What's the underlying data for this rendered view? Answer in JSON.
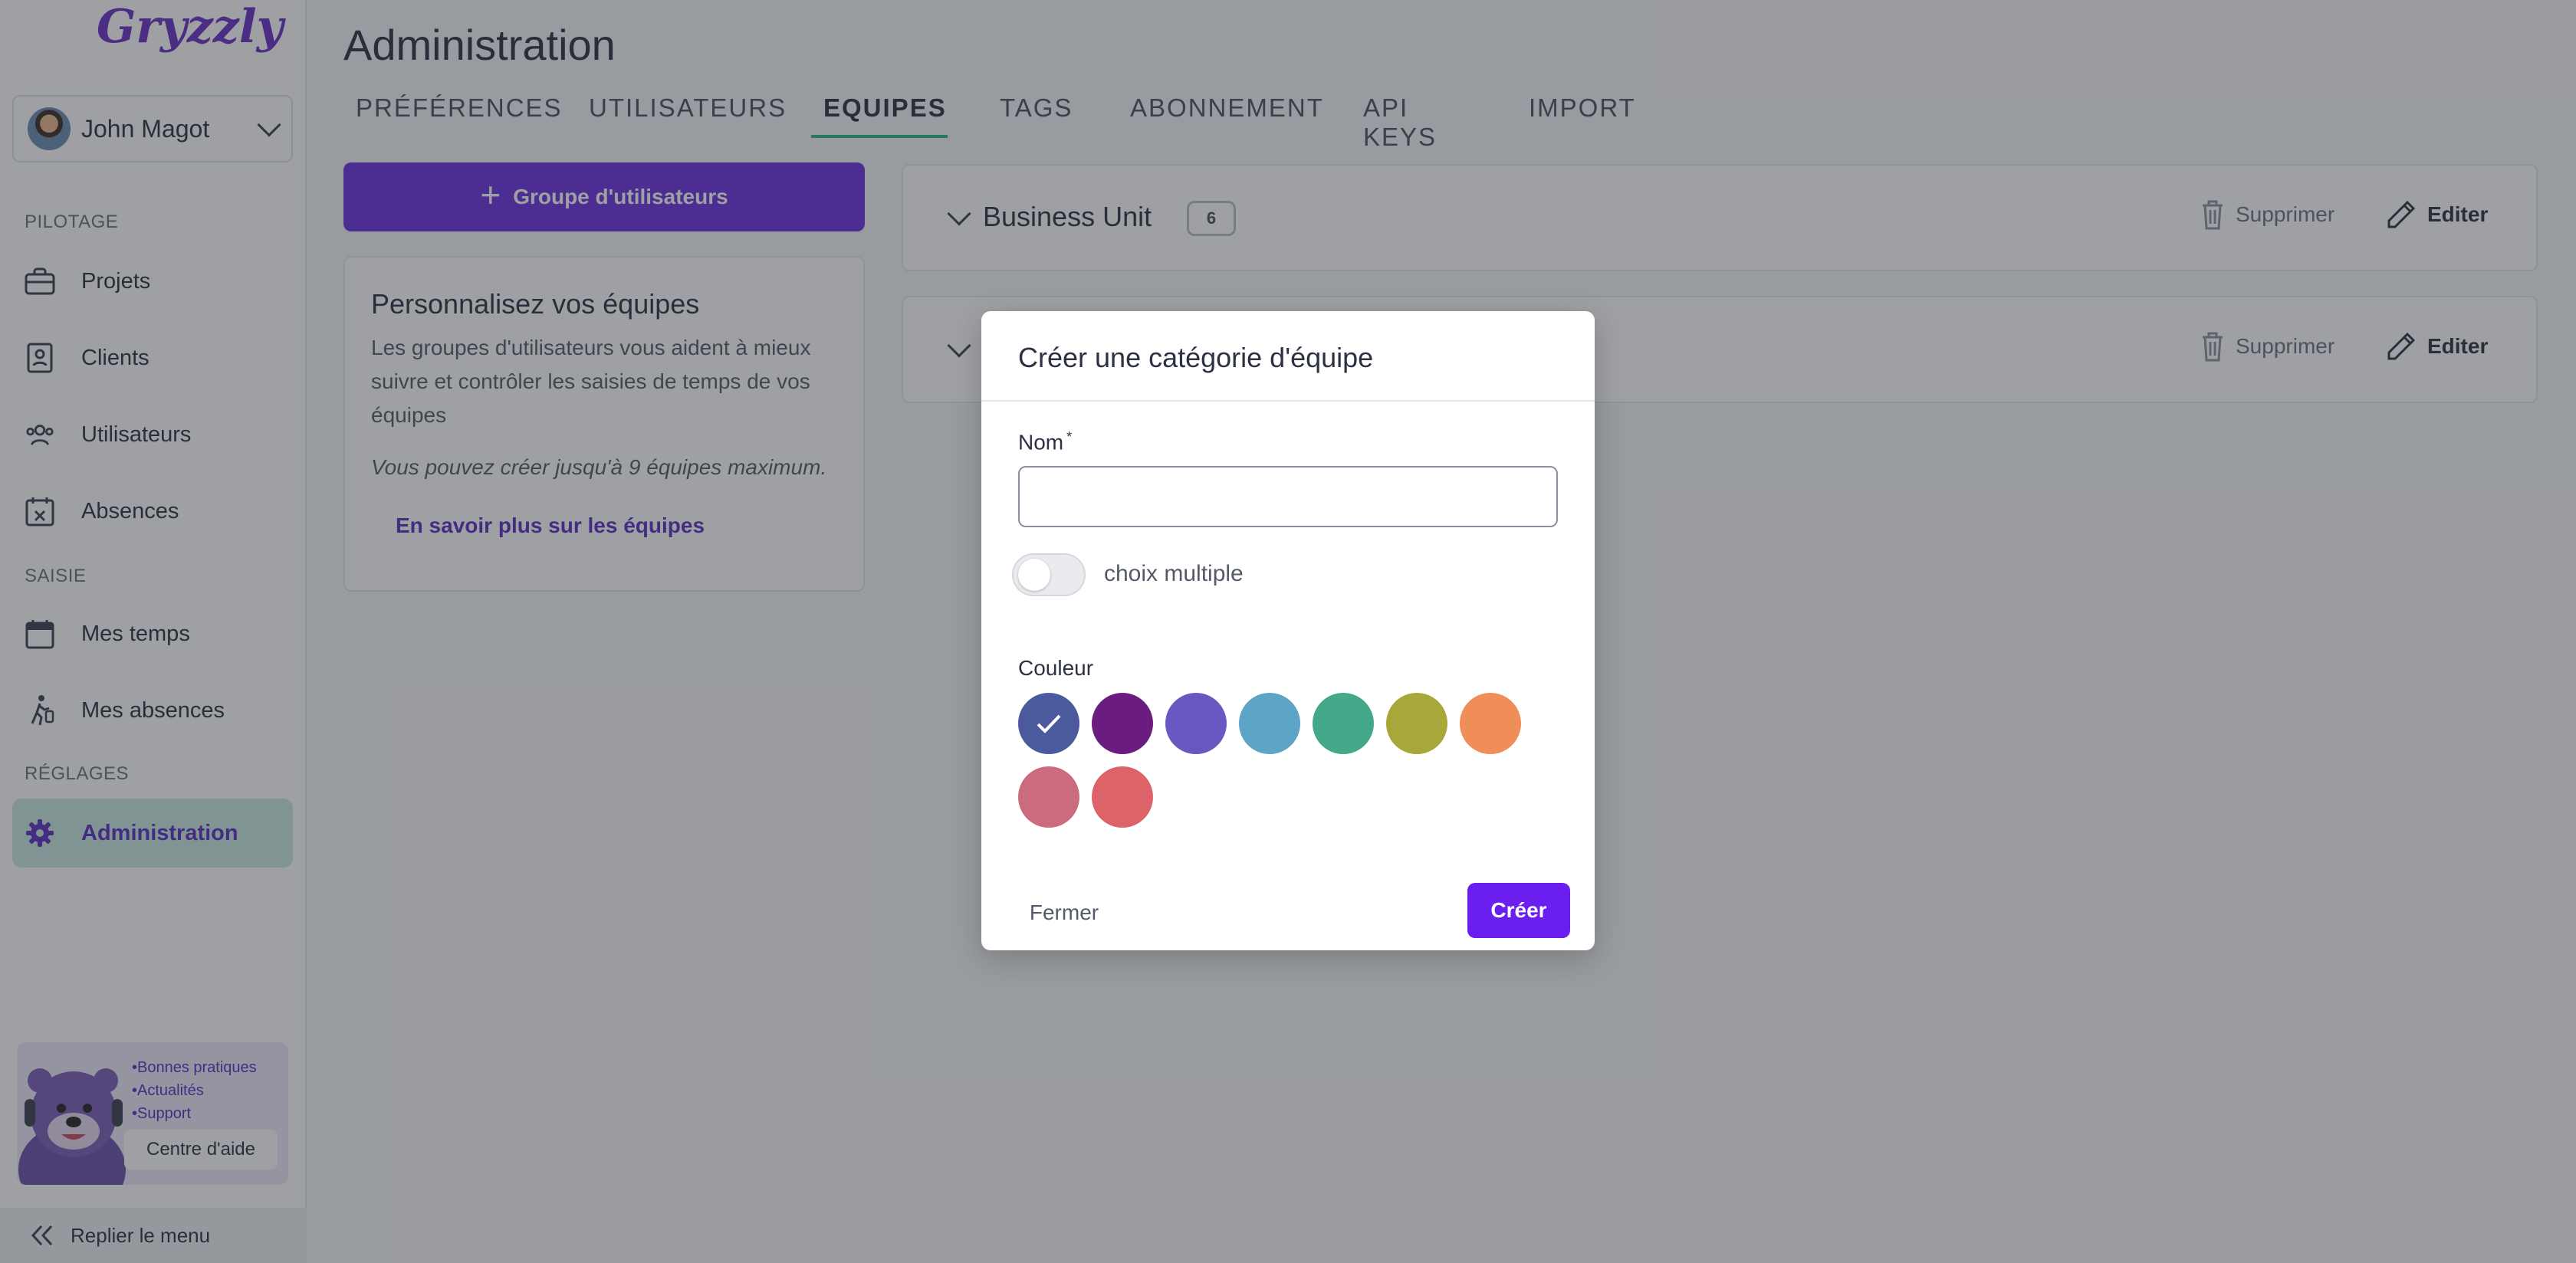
{
  "app": {
    "logo_text": "Gryzzly"
  },
  "user": {
    "name": "John Magot"
  },
  "sidebar": {
    "sections": [
      {
        "label": "PILOTAGE"
      },
      {
        "label": "SAISIE"
      },
      {
        "label": "RÉGLAGES"
      }
    ],
    "items": [
      {
        "label": "Projets",
        "icon": "briefcase-icon"
      },
      {
        "label": "Clients",
        "icon": "contact-card-icon"
      },
      {
        "label": "Utilisateurs",
        "icon": "users-icon"
      },
      {
        "label": "Absences",
        "icon": "calendar-x-icon"
      },
      {
        "label": "Mes temps",
        "icon": "calendar-icon"
      },
      {
        "label": "Mes absences",
        "icon": "walking-person-icon"
      },
      {
        "label": "Administration",
        "icon": "gear-icon",
        "active": true
      }
    ],
    "help": {
      "items": [
        "•Bonnes pratiques",
        "•Actualités",
        "•Support"
      ],
      "button_label": "Centre d'aide"
    },
    "collapse_label": "Replier le menu"
  },
  "main": {
    "title": "Administration",
    "tabs": [
      {
        "label": "PRÉFÉRENCES"
      },
      {
        "label": "UTILISATEURS"
      },
      {
        "label": "EQUIPES",
        "active": true
      },
      {
        "label": "TAGS"
      },
      {
        "label": "ABONNEMENT"
      },
      {
        "label": "API KEYS"
      },
      {
        "label": "IMPORT"
      }
    ],
    "add_group_label": "Groupe d'utilisateurs",
    "info": {
      "title": "Personnalisez vos équipes",
      "text": "Les groupes d'utilisateurs vous aident à mieux suivre et contrôler les saisies de temps de vos équipes",
      "limit": "Vous pouvez créer jusqu'à 9 équipes maximum.",
      "link": "En savoir plus sur les équipes"
    },
    "teams": [
      {
        "name": "Business Unit",
        "count": "6",
        "delete_label": "Supprimer",
        "edit_label": "Editer"
      },
      {
        "name": "",
        "count": "",
        "delete_label": "Supprimer",
        "edit_label": "Editer"
      }
    ]
  },
  "modal": {
    "title": "Créer une catégorie d'équipe",
    "name_label": "Nom",
    "required_mark": "*",
    "name_value": "",
    "multiple_label": "choix multiple",
    "multiple_enabled": false,
    "color_label": "Couleur",
    "colors": [
      "#4a5a9c",
      "#6b1c80",
      "#6a58c2",
      "#5ea4c6",
      "#44a88a",
      "#a8a83a",
      "#f08d58",
      "#cc6b7e",
      "#dc6468"
    ],
    "selected_color_index": 0,
    "close_label": "Fermer",
    "create_label": "Créer"
  }
}
